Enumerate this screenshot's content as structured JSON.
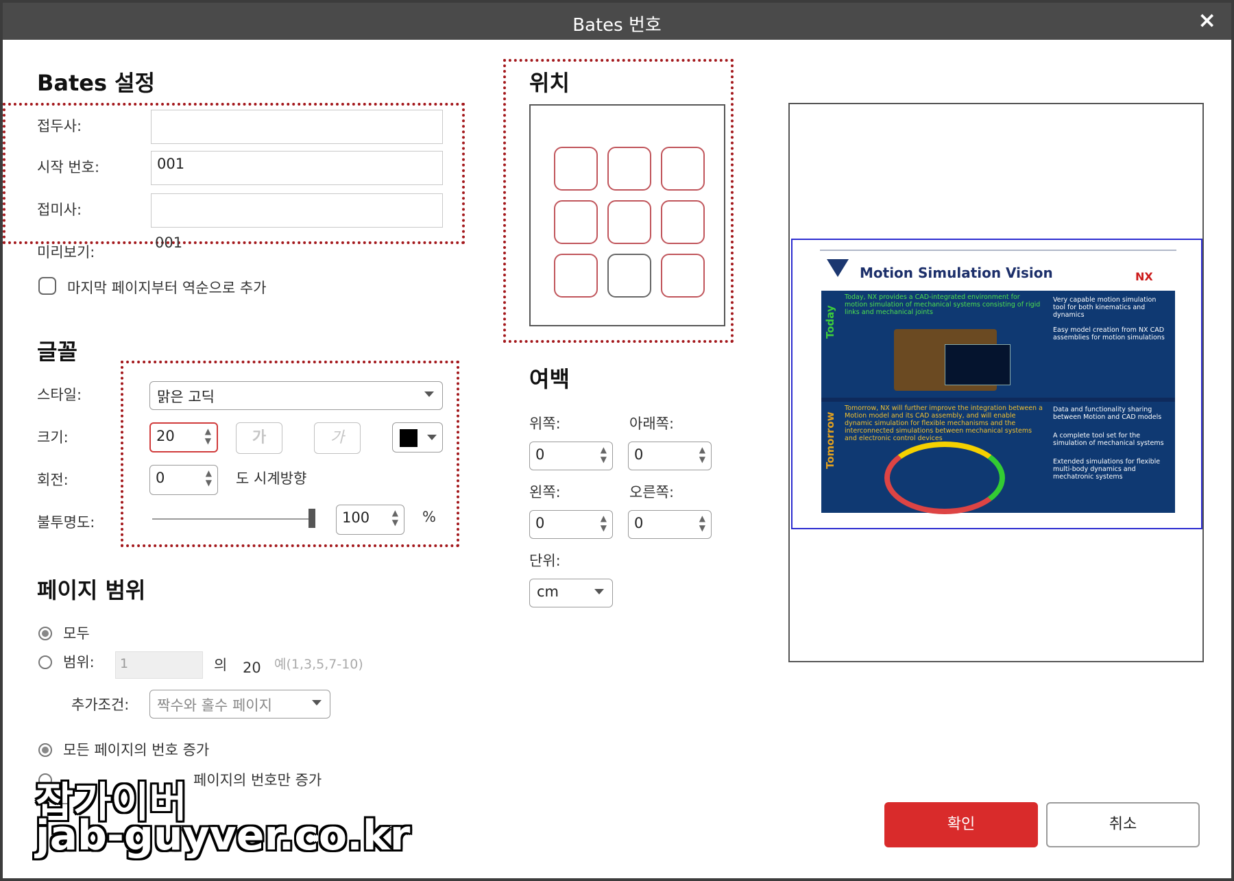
{
  "window": {
    "title": "Bates 번호",
    "close_icon": "×"
  },
  "bates": {
    "heading": "Bates 설정",
    "prefix_label": "접두사:",
    "prefix_value": "",
    "start_label": "시작 번호:",
    "start_value": "001",
    "suffix_label": "접미사:",
    "suffix_value": "",
    "preview_label": "미리보기:",
    "preview_value": "001",
    "reverse_label": "마지막 페이지부터 역순으로 추가"
  },
  "font": {
    "heading": "글꼴",
    "style_label": "스타일:",
    "style_value": "맑은 고딕",
    "size_label": "크기:",
    "size_value": "20",
    "bold_label": "가",
    "italic_label": "가",
    "color_value": "#000000",
    "rotation_label": "회전:",
    "rotation_value": "0",
    "rotation_unit": "도 시계방향",
    "opacity_label": "불투명도:",
    "opacity_value": "100",
    "opacity_unit": "%",
    "opacity_fraction": 1.0
  },
  "page_range": {
    "heading": "페이지 범위",
    "all_label": "모두",
    "range_label": "범위:",
    "range_value": "1",
    "of_label": "의",
    "total": "20",
    "example": "예(1,3,5,7-10)",
    "condition_label": "추가조건:",
    "condition_value": "짝수와 홀수 페이지",
    "increment_all_label": "모든 페이지의 번호 증가",
    "increment_some_label": "페이지의 번호만 증가"
  },
  "position": {
    "heading": "위치",
    "selected_index": 7
  },
  "margin": {
    "heading": "여백",
    "top_label": "위쪽:",
    "top_value": "0",
    "bottom_label": "아래쪽:",
    "bottom_value": "0",
    "left_label": "왼쪽:",
    "left_value": "0",
    "right_label": "오른쪽:",
    "right_value": "0",
    "unit_label": "단위:",
    "unit_value": "cm"
  },
  "preview_slide": {
    "title": "Motion Simulation Vision",
    "logo": "NX",
    "today_label": "Today",
    "tomorrow_label": "Tomorrow",
    "today_text": "Today, NX provides a CAD-integrated environment for motion simulation of mechanical systems consisting of rigid links and mechanical joints",
    "tomorrow_text": "Tomorrow, NX will further improve the integration between a Motion model and its CAD assembly, and will enable dynamic simulation for flexible mechanisms and the interconnected simulations between mechanical systems and electronic control devices",
    "today_bullets": [
      "Very capable motion simulation tool for both kinematics and dynamics",
      "Easy model creation from NX CAD assemblies for motion simulations"
    ],
    "tomorrow_bullets": [
      "Data and functionality sharing between Motion and CAD models",
      "A complete tool set for the simulation of mechanical systems",
      "Extended simulations for flexible multi-body dynamics and mechatronic systems"
    ]
  },
  "buttons": {
    "ok": "확인",
    "cancel": "취소"
  },
  "watermark": {
    "line1": "잡가이버",
    "line2": "jab-guyver.co.kr"
  }
}
